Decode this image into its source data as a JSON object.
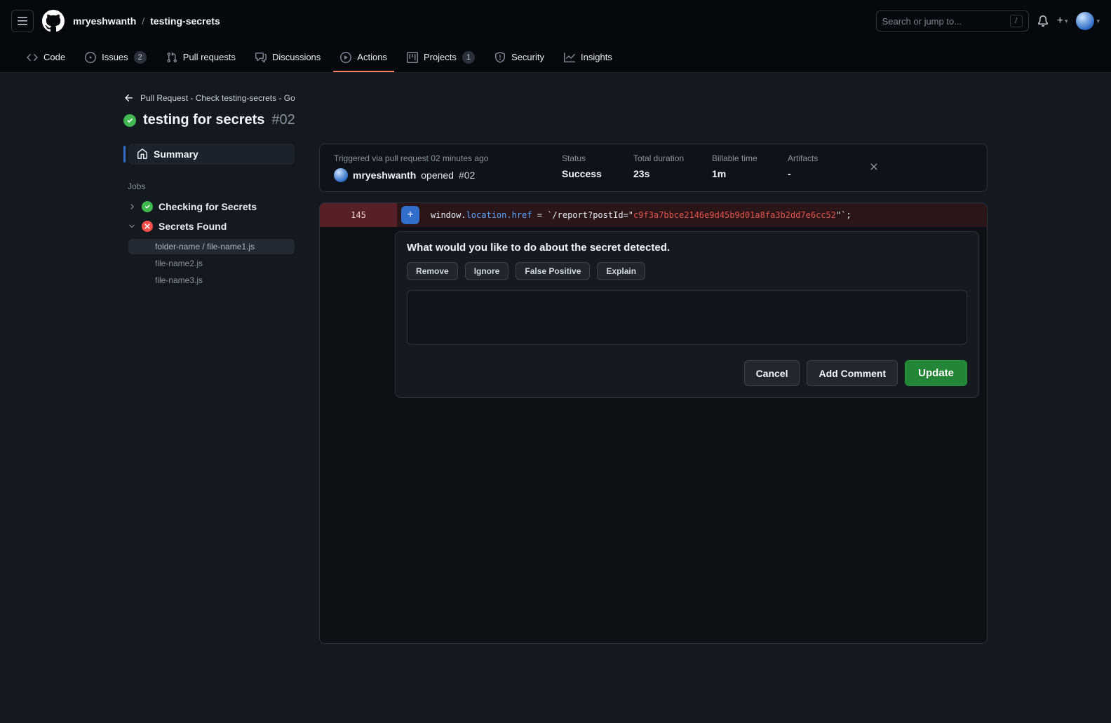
{
  "header": {
    "owner": "mryeshwanth",
    "path_separator": "/",
    "repo": "testing-secrets",
    "search_placeholder": "Search or jump to...",
    "search_shortcut": "/",
    "plus_label": "+",
    "caret": "▾"
  },
  "nav": {
    "active_tab": "Actions",
    "tabs": [
      {
        "label": "Code"
      },
      {
        "label": "Issues",
        "count": "2"
      },
      {
        "label": "Pull requests"
      },
      {
        "label": "Discussions"
      },
      {
        "label": "Actions"
      },
      {
        "label": "Projects",
        "count": "1"
      },
      {
        "label": "Security"
      },
      {
        "label": "Insights"
      }
    ]
  },
  "run": {
    "breadcrumb": "Pull Request - Check testing-secrets - Go",
    "title": "testing for secrets",
    "number": "#02",
    "status": "success"
  },
  "sidebar": {
    "summary_label": "Summary",
    "jobs_heading": "Jobs",
    "jobs": [
      {
        "name": "Checking for Secrets",
        "status": "success"
      },
      {
        "name": "Secrets Found",
        "status": "failure",
        "expanded": true
      }
    ],
    "files": [
      {
        "label": "folder-name / file-name1.js",
        "selected": true
      },
      {
        "label": "file-name2.js",
        "selected": false
      },
      {
        "label": "file-name3.js",
        "selected": false
      }
    ]
  },
  "summary_card": {
    "triggered_text": "Triggered via pull request 02 minutes ago",
    "author": "mryeshwanth",
    "action": "opened",
    "pr_number": "#02",
    "stats": [
      {
        "label": "Status",
        "value": "Success"
      },
      {
        "label": "Total duration",
        "value": "23s"
      },
      {
        "label": "Billable time",
        "value": "1m"
      },
      {
        "label": "Artifacts",
        "value": "-"
      }
    ]
  },
  "diff": {
    "line_number": "145",
    "add_button": "+",
    "code": {
      "object": "window.",
      "property": "location.href",
      "operator": " = ",
      "string_open": "`/report?postId=\"",
      "secret": "c9f3a7bbce2146e9d45b9d01a8fa3b2dd7e6cc52",
      "string_close": "\"`;"
    }
  },
  "modal": {
    "title": "What would you like to do about the secret detected.",
    "action_chips": [
      {
        "label": "Remove"
      },
      {
        "label": "Ignore"
      },
      {
        "label": "False Positive"
      },
      {
        "label": "Explain"
      }
    ],
    "comment_value": "",
    "buttons": {
      "cancel": "Cancel",
      "add_comment": "Add Comment",
      "update": "Update"
    }
  },
  "icons": {
    "menu": "three-bars",
    "logo": "github-mark",
    "notifications": "bell",
    "back": "arrow-left",
    "run_success": "check-circle-fill-green",
    "job_failure": "x-circle-fill-red",
    "summary": "home",
    "close_card": "x",
    "add_line_comment": "plus"
  },
  "colors": {
    "accent_blue": "#316dca",
    "success_green": "#238636",
    "check_green": "#3fb950",
    "fail_red": "#f85149",
    "tab_underline": "#f78166",
    "secret_red": "#e5534b"
  }
}
